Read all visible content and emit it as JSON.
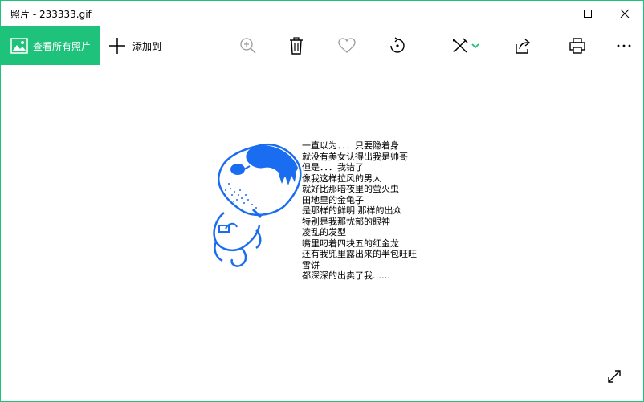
{
  "window": {
    "title": "照片 - 233333.gif",
    "accent_color": "#1ec27a"
  },
  "toolbar": {
    "view_all_label": "查看所有照片",
    "add_to_label": "添加到",
    "icons": [
      "photos-icon",
      "plus-icon",
      "zoom-icon",
      "delete-icon",
      "heart-icon",
      "rotate-icon",
      "edit-icon",
      "share-icon",
      "print-icon",
      "more-icon"
    ]
  },
  "image": {
    "caption_lines": [
      "一直以为．．．只要隐着身",
      "就没有美女认得出我是帅哥",
      "但是．．．我错了",
      "像我这样拉风的男人",
      "就好比那暗夜里的萤火虫",
      "田地里的金龟子",
      "是那样的鲜明 那样的出众",
      "特别是我那忧郁的眼神",
      "凌乱的发型",
      "嘴里叼着四块五的红金龙",
      "还有我兜里露出来的半包旺旺",
      "雪饼",
      "都深深的出卖了我……"
    ],
    "drawing_color": "#1a6cf0"
  }
}
